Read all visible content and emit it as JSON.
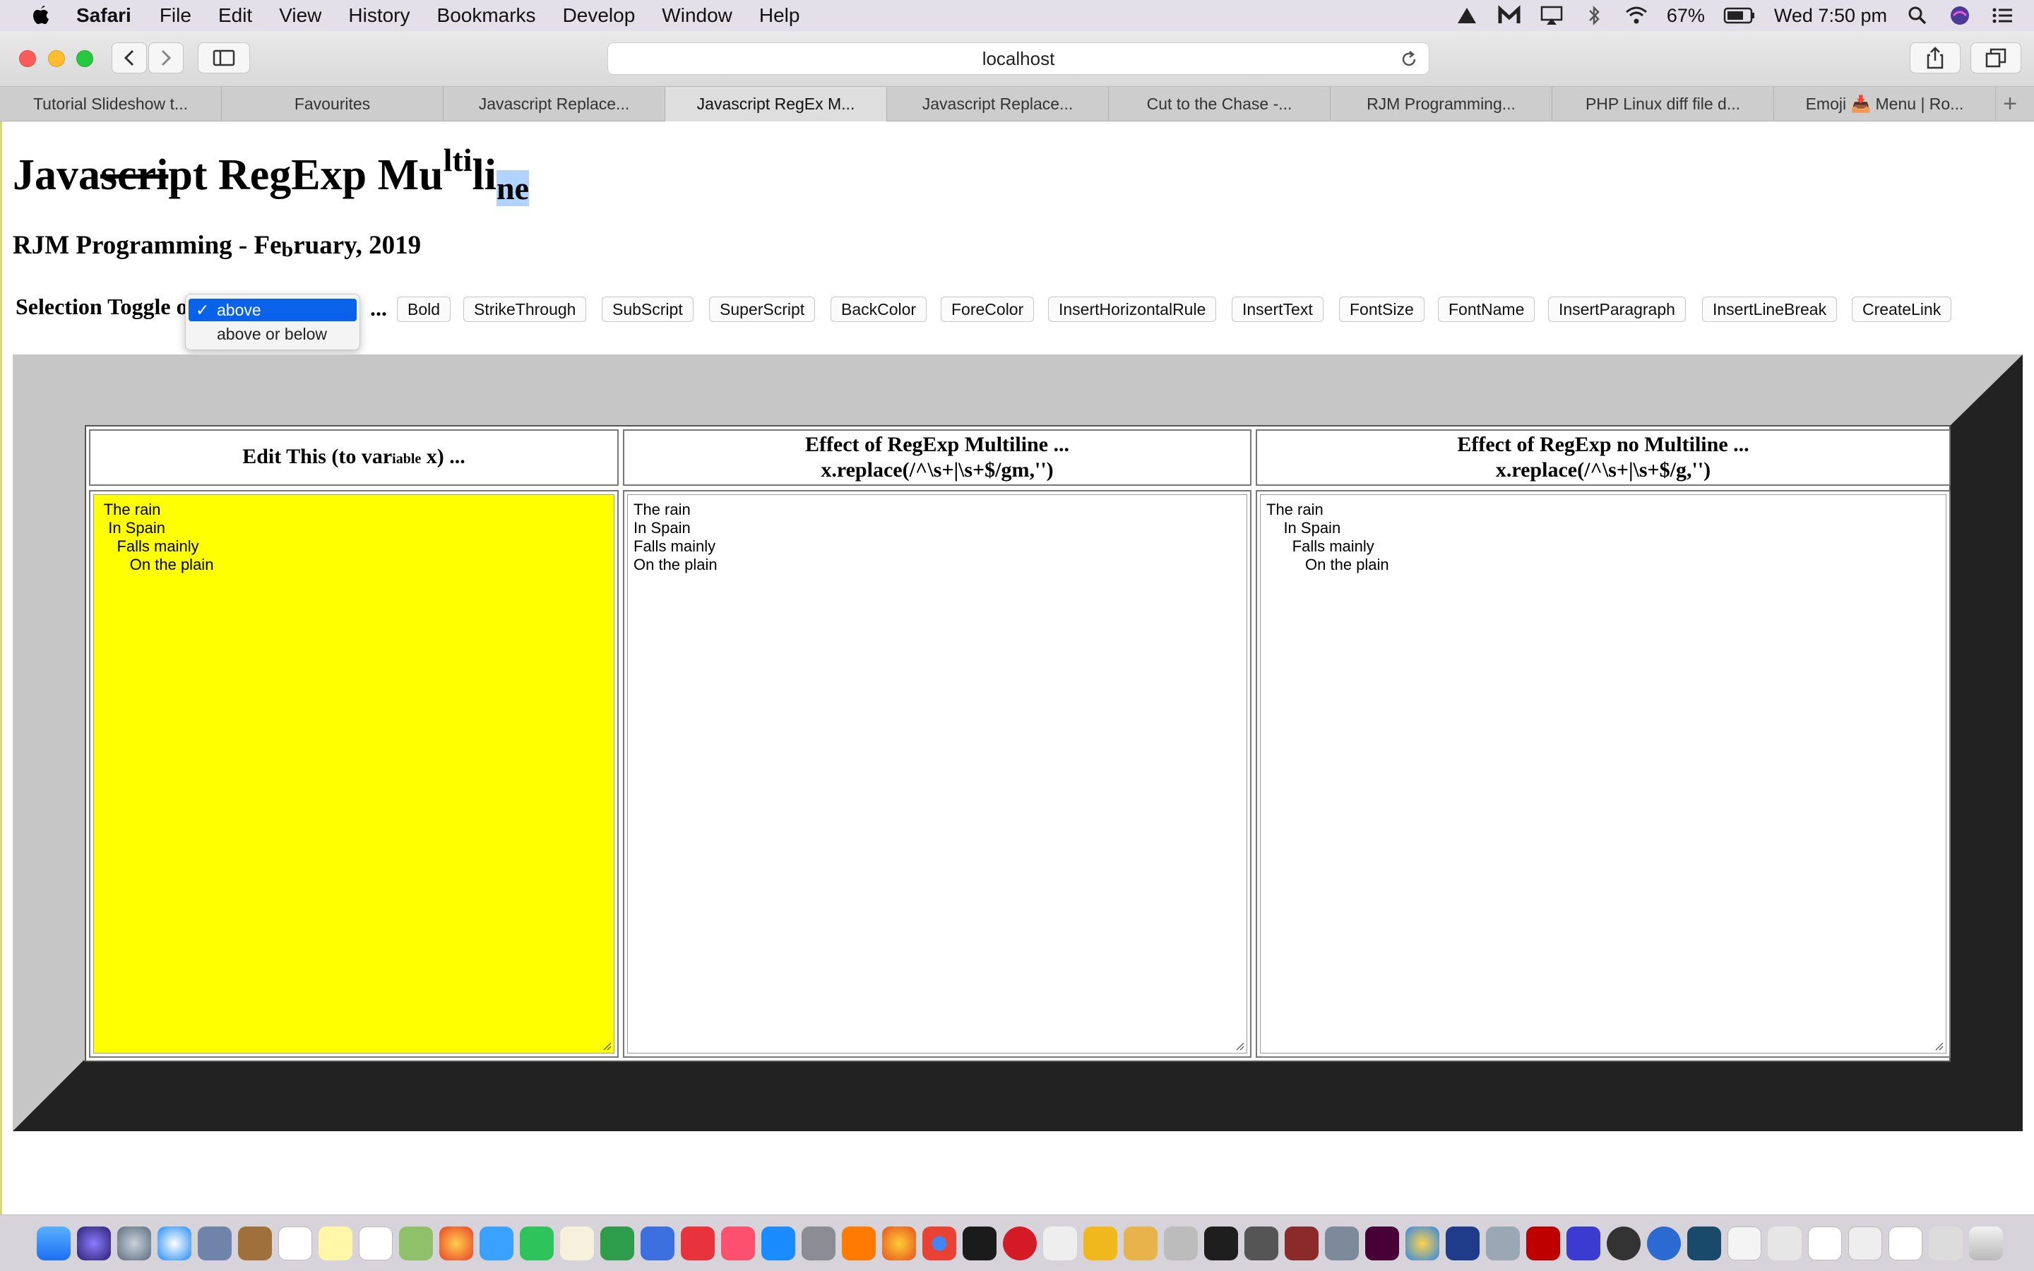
{
  "menubar": {
    "app_name": "Safari",
    "items": [
      "File",
      "Edit",
      "View",
      "History",
      "Bookmarks",
      "Develop",
      "Window",
      "Help"
    ],
    "battery": "67%",
    "clock": "Wed 7:50 pm"
  },
  "toolbar": {
    "address": "localhost"
  },
  "tabs": [
    {
      "label": "Tutorial Slideshow t..."
    },
    {
      "label": "Favourites"
    },
    {
      "label": "Javascript Replace..."
    },
    {
      "label": "Javascript RegEx M..."
    },
    {
      "label": "Javascript Replace..."
    },
    {
      "label": "Cut to the Chase -..."
    },
    {
      "label": "RJM Programming..."
    },
    {
      "label": "PHP Linux diff file d..."
    },
    {
      "label": "Emoji 📥 Menu | Ro..."
    }
  ],
  "page": {
    "h1_part1": "Java",
    "h1_strike": "scri",
    "h1_part2": "pt RegExp Mu",
    "h1_sup": "lti",
    "h1_part3": "li",
    "h1_sub": "ne",
    "h2_a": "RJM Programming - Fe",
    "h2_sub": "b",
    "h2_b": "ruary, 2019",
    "toggle_label": "Selection Toggle o",
    "dropdown": {
      "options": [
        "above",
        "above or below"
      ],
      "selected": "above"
    },
    "ellipsis": "...",
    "commands": [
      "Bold",
      "StrikeThrough",
      "SubScript",
      "SuperScript",
      "BackColor",
      "ForeColor",
      "InsertHorizontalRule",
      "InsertText",
      "FontSize",
      "FontName",
      "InsertParagraph",
      "InsertLineBreak",
      "CreateLink"
    ]
  },
  "table": {
    "col1": {
      "a": "Edit This (to var",
      "small": "iable",
      "b": " x) ..."
    },
    "col2": {
      "line1": "Effect of RegExp Multiline ...",
      "line2": "x.replace(/^\\s+|\\s+$/gm,'')"
    },
    "col3": {
      "line1": "Effect of RegExp no Multiline ...",
      "line2": "x.replace(/^\\s+|\\s+$/g,'')"
    },
    "edit_text": " The rain\n  In Spain\n    Falls mainly\n       On the plain",
    "multiline_text": "The rain\nIn Spain\nFalls mainly\nOn the plain",
    "no_multiline_text": "The rain\n    In Spain\n      Falls mainly\n         On the plain"
  },
  "colors": {
    "edit_bg": "#ffff00",
    "frame_light": "#c6c6c6",
    "frame_dark": "#222222",
    "selection": "#0a62ea"
  }
}
